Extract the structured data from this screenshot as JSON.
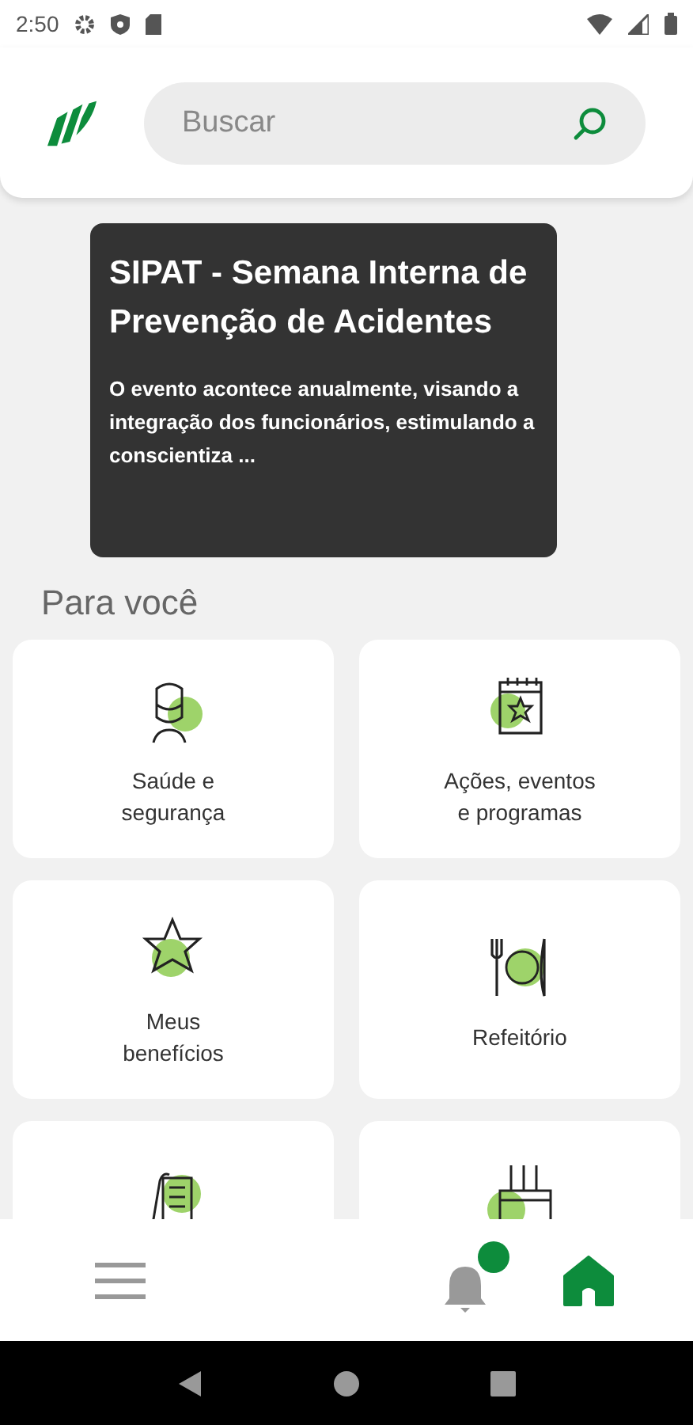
{
  "status_bar": {
    "time": "2:50"
  },
  "search": {
    "placeholder": "Buscar"
  },
  "banner": {
    "title": "SIPAT - Semana Interna de Prevenção de Acidentes",
    "text": "O evento acontece anualmente, visando a integração dos funcionários, estimulando a conscientiza ..."
  },
  "section_title": "Para você",
  "cards": [
    {
      "kind": "full",
      "label": "Saúde e\nsegurança"
    },
    {
      "kind": "full",
      "label": "Ações, eventos\ne programas"
    },
    {
      "kind": "full",
      "label": "Meus\nbenefícios"
    },
    {
      "kind": "full",
      "label": "Refeitório"
    },
    {
      "kind": "partial"
    },
    {
      "kind": "partial"
    }
  ],
  "bottom_nav": [
    {
      "kind": "menu",
      "selected": false
    },
    {
      "kind": "notifications",
      "selected": false,
      "unread": true
    },
    {
      "kind": "home",
      "selected": true
    }
  ]
}
